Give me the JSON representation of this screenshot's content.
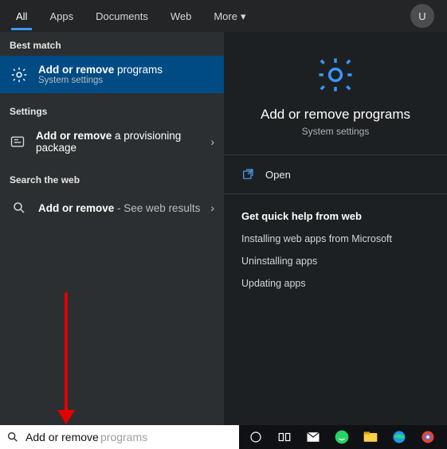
{
  "tabs": {
    "all": "All",
    "apps": "Apps",
    "documents": "Documents",
    "web": "Web",
    "more": "More"
  },
  "avatar_letter": "U",
  "left": {
    "best_match_label": "Best match",
    "best_match": {
      "title_bold": "Add or remove",
      "title_rest": " programs",
      "subtitle": "System settings"
    },
    "settings_label": "Settings",
    "settings_item": {
      "title_bold": "Add or remove",
      "title_rest": " a provisioning package"
    },
    "web_label": "Search the web",
    "web_item": {
      "title_bold": "Add or remove",
      "title_rest": " - See web results"
    }
  },
  "preview": {
    "title": "Add or remove programs",
    "subtitle": "System settings",
    "open_label": "Open",
    "help_title": "Get quick help from web",
    "help_links": [
      "Installing web apps from Microsoft",
      "Uninstalling apps",
      "Updating apps"
    ]
  },
  "search": {
    "value": "Add or remove ",
    "ghost": "programs"
  }
}
